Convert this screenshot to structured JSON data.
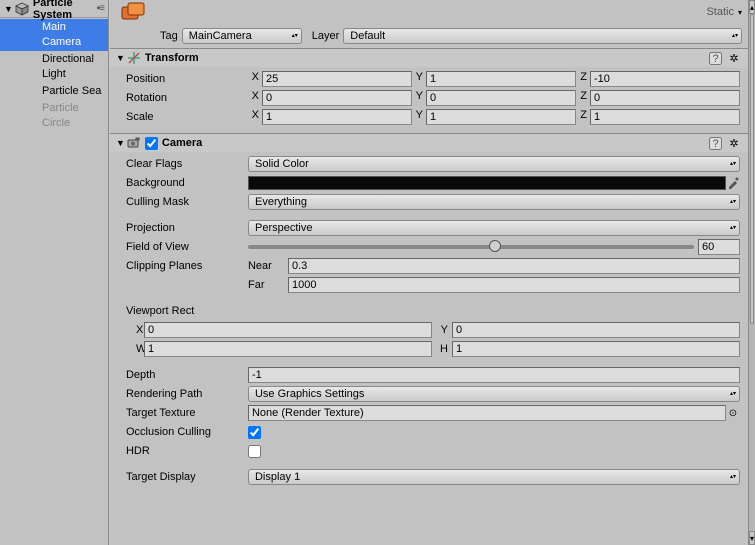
{
  "hierarchy": {
    "title": "Particle System",
    "items": [
      {
        "label": "Main Camera",
        "selected": true
      },
      {
        "label": "Directional Light"
      },
      {
        "label": "Particle Sea"
      },
      {
        "label": "Particle Circle",
        "faded": true
      }
    ]
  },
  "inspector": {
    "tag_label": "Tag",
    "tag_value": "MainCamera",
    "layer_label": "Layer",
    "layer_value": "Default",
    "static_label": "Static"
  },
  "transform": {
    "title": "Transform",
    "position_label": "Position",
    "rotation_label": "Rotation",
    "scale_label": "Scale",
    "axis": {
      "x": "X",
      "y": "Y",
      "z": "Z"
    },
    "position": {
      "x": "25",
      "y": "1",
      "z": "-10"
    },
    "rotation": {
      "x": "0",
      "y": "0",
      "z": "0"
    },
    "scale": {
      "x": "1",
      "y": "1",
      "z": "1"
    }
  },
  "camera": {
    "title": "Camera",
    "enabled": true,
    "clear_flags_label": "Clear Flags",
    "clear_flags": "Solid Color",
    "background_label": "Background",
    "background_color": "#0a0a0a",
    "culling_mask_label": "Culling Mask",
    "culling_mask": "Everything",
    "projection_label": "Projection",
    "projection": "Perspective",
    "fov_label": "Field of View",
    "fov": "60",
    "fov_percent": 54,
    "clipping_label": "Clipping Planes",
    "near_label": "Near",
    "near": "0.3",
    "far_label": "Far",
    "far": "1000",
    "viewport_label": "Viewport Rect",
    "vp_x_label": "X",
    "vp_x": "0",
    "vp_y_label": "Y",
    "vp_y": "0",
    "vp_w_label": "W",
    "vp_w": "1",
    "vp_h_label": "H",
    "vp_h": "1",
    "depth_label": "Depth",
    "depth": "-1",
    "rendering_path_label": "Rendering Path",
    "rendering_path": "Use Graphics Settings",
    "target_texture_label": "Target Texture",
    "target_texture": "None (Render Texture)",
    "occlusion_label": "Occlusion Culling",
    "occlusion": true,
    "hdr_label": "HDR",
    "hdr": false,
    "target_display_label": "Target Display",
    "target_display": "Display 1"
  }
}
